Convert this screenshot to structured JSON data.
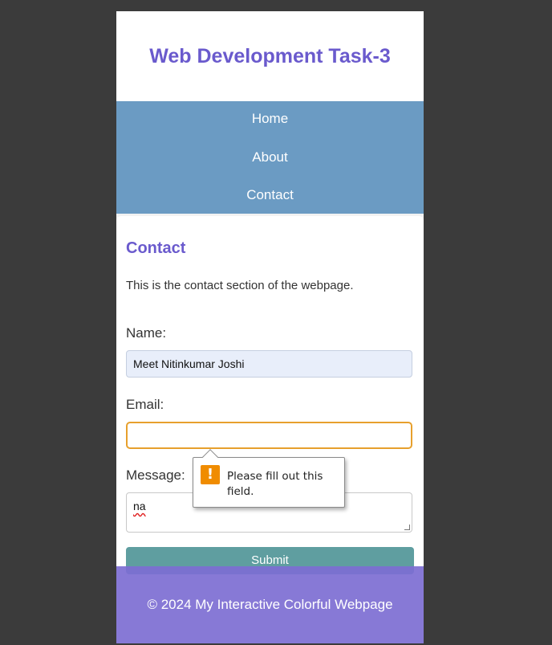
{
  "header": {
    "title": "Web Development Task-3"
  },
  "nav": {
    "items": [
      {
        "label": "Home"
      },
      {
        "label": "About"
      },
      {
        "label": "Contact"
      }
    ]
  },
  "contact": {
    "title": "Contact",
    "description": "This is the contact section of the webpage.",
    "name_label": "Name:",
    "name_value": "Meet Nitinkumar Joshi",
    "email_label": "Email:",
    "email_value": "",
    "message_label": "Message:",
    "message_value": "na",
    "submit_label": "Submit"
  },
  "validation_tooltip": {
    "message": "Please fill out this field.",
    "icon": "warning-icon"
  },
  "footer": {
    "text": "© 2024 My Interactive Colorful Webpage"
  },
  "colors": {
    "title": "#6a5acd",
    "nav_bg": "#6b9bc3",
    "submit_bg": "#5f9ea0",
    "footer_bg": "#7d6ed3",
    "invalid_border": "#e7a02d",
    "warning": "#f08c00"
  }
}
